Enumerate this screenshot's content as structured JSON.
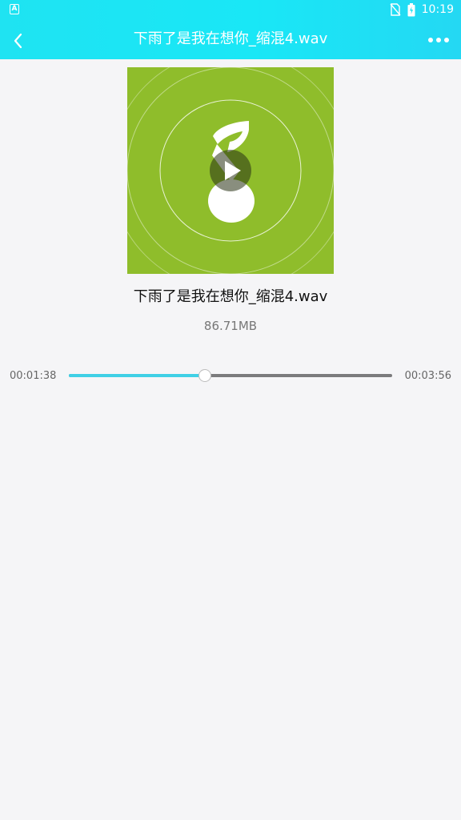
{
  "statusbar": {
    "left_icon": "a-notification-icon",
    "icons": [
      "no-sim-icon",
      "battery-icon"
    ],
    "time": "10:19"
  },
  "appbar": {
    "back_icon": "chevron-left-icon",
    "title": "下雨了是我在想你_缩混4.wav",
    "more_icon": "more-horizontal-icon",
    "color": "#1fe3f2"
  },
  "player": {
    "album_art": {
      "icon": "music-note-icon",
      "play_icon": "play-icon",
      "color": "#8fbd2b"
    },
    "song_name": "下雨了是我在想你_缩混4.wav",
    "file_size": "86.71MB",
    "current_time": "00:01:38",
    "total_time": "00:03:56",
    "progress": 0.42,
    "accent_color": "#3fd0e6"
  }
}
